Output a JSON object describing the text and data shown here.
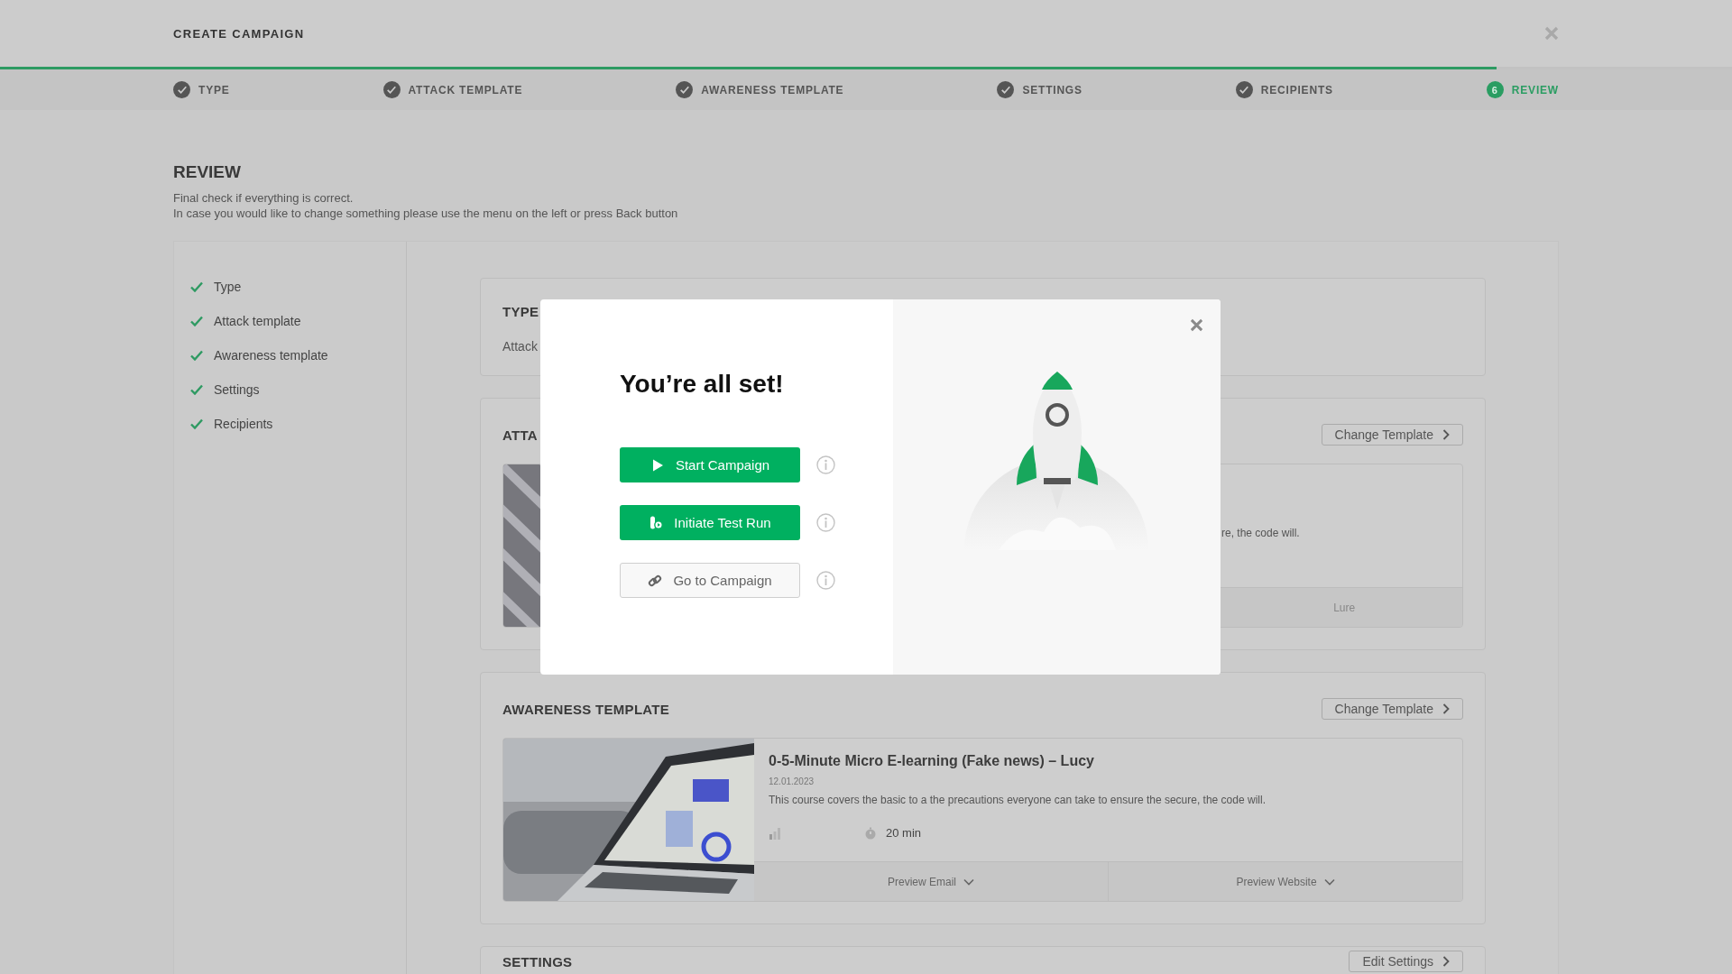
{
  "header": {
    "title": "CREATE CAMPAIGN"
  },
  "progress": {
    "level": 0.864
  },
  "steps": [
    {
      "label": "TYPE",
      "done": true,
      "selected": false
    },
    {
      "label": "ATTACK TEMPLATE",
      "done": true,
      "selected": false
    },
    {
      "label": "AWARENESS TEMPLATE",
      "done": true,
      "selected": false
    },
    {
      "label": "SETTINGS",
      "done": true,
      "selected": false
    },
    {
      "label": "RECIPIENTS",
      "done": true,
      "selected": false
    },
    {
      "label": "REVIEW",
      "number": "6",
      "done": false,
      "selected": true
    }
  ],
  "review": {
    "title": "REVIEW",
    "lines": [
      "Final check if everything is correct.",
      "In case you would like to change something please use the menu on the left or press Back button"
    ]
  },
  "nav": [
    {
      "label": "Type",
      "done": true
    },
    {
      "label": "Attack template",
      "done": true
    },
    {
      "label": "Awareness template",
      "done": true
    },
    {
      "label": "Settings",
      "done": true
    },
    {
      "label": "Recipients",
      "done": true
    }
  ],
  "cards": [
    {
      "kind": "text",
      "title": "TYPE",
      "value": "Attack"
    },
    {
      "kind": "template",
      "title": "ATTA",
      "button": "Change Template",
      "description": "re, the code will.",
      "footer": [
        {
          "label": "Lure",
          "kind": "plain"
        }
      ]
    },
    {
      "kind": "template",
      "title": "AWARENESS TEMPLATE",
      "button": "Change Template",
      "name": "0-5-Minute Micro E-learning (Fake news) – Lucy",
      "date": "12.01.2023",
      "description": "This course covers the basic to a the precautions everyone can take to ensure the secure, the code will.",
      "duration": "20 min",
      "footer": [
        {
          "label": "Preview Email",
          "kind": "dropdown"
        },
        {
          "label": "Preview Website",
          "kind": "dropdown"
        }
      ]
    },
    {
      "kind": "header",
      "title": "SETTINGS",
      "button": "Edit Settings"
    }
  ],
  "modal": {
    "title": "You’re all set!",
    "actions": [
      {
        "label": "Start Campaign",
        "kind": "primary"
      },
      {
        "label": "Initiate Test Run",
        "kind": "primary"
      },
      {
        "label": "Go to Campaign",
        "kind": "secondary"
      }
    ]
  }
}
